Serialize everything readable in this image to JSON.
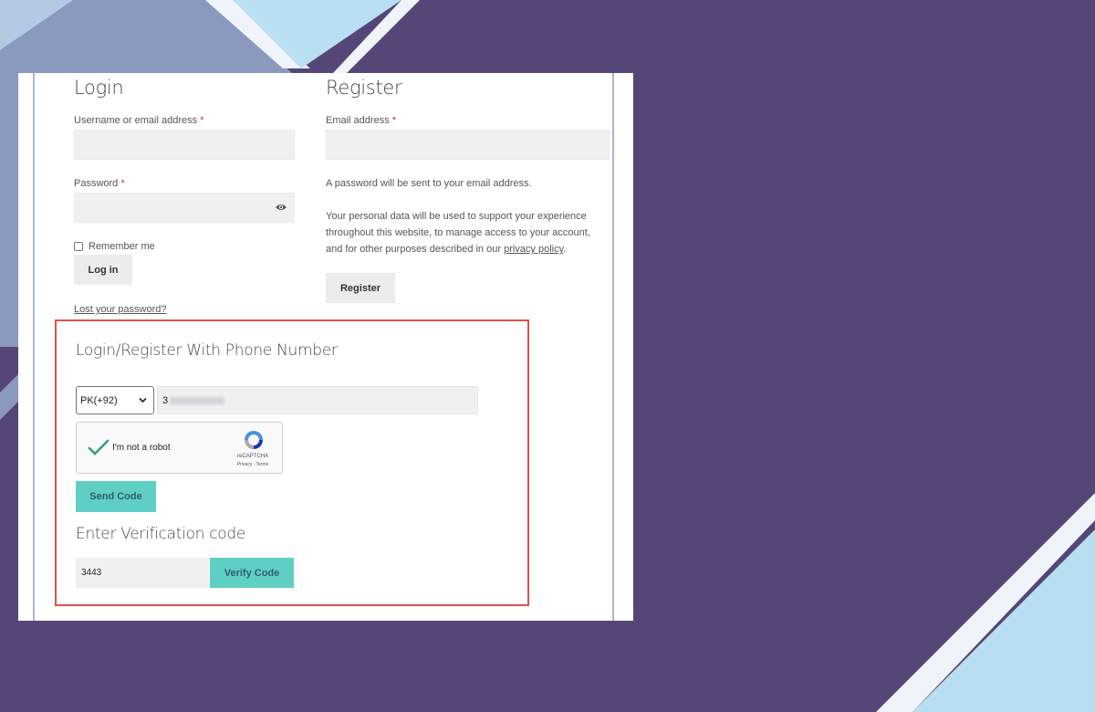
{
  "login": {
    "title": "Login",
    "username_label": "Username or email address",
    "password_label": "Password",
    "required_mark": "*",
    "remember_label": "Remember me",
    "login_button": "Log in",
    "lost_password": "Lost your password?"
  },
  "register": {
    "title": "Register",
    "email_label": "Email address",
    "required_mark": "*",
    "password_note": "A password will be sent to your email address.",
    "privacy_text_1": "Your personal data will be used to support your experience",
    "privacy_text_2": "throughout this website, to manage access to your account,",
    "privacy_text_3": "and for other purposes described in our",
    "privacy_link": "privacy policy",
    "privacy_end": ".",
    "register_button": "Register"
  },
  "phone": {
    "title": "Login/Register With Phone Number",
    "country_selected": "PK(+92)",
    "phone_value": "3",
    "captcha_label": "I'm not a robot",
    "captcha_brand": "reCAPTCHA",
    "captcha_terms": "Privacy - Terms",
    "send_button": "Send Code",
    "verify_title": "Enter Verification code",
    "code_value": "3443",
    "verify_button": "Verify Code"
  },
  "colors": {
    "background": "#564577",
    "accent_teal": "#5fcfc3",
    "highlight_red": "#d9534f"
  }
}
